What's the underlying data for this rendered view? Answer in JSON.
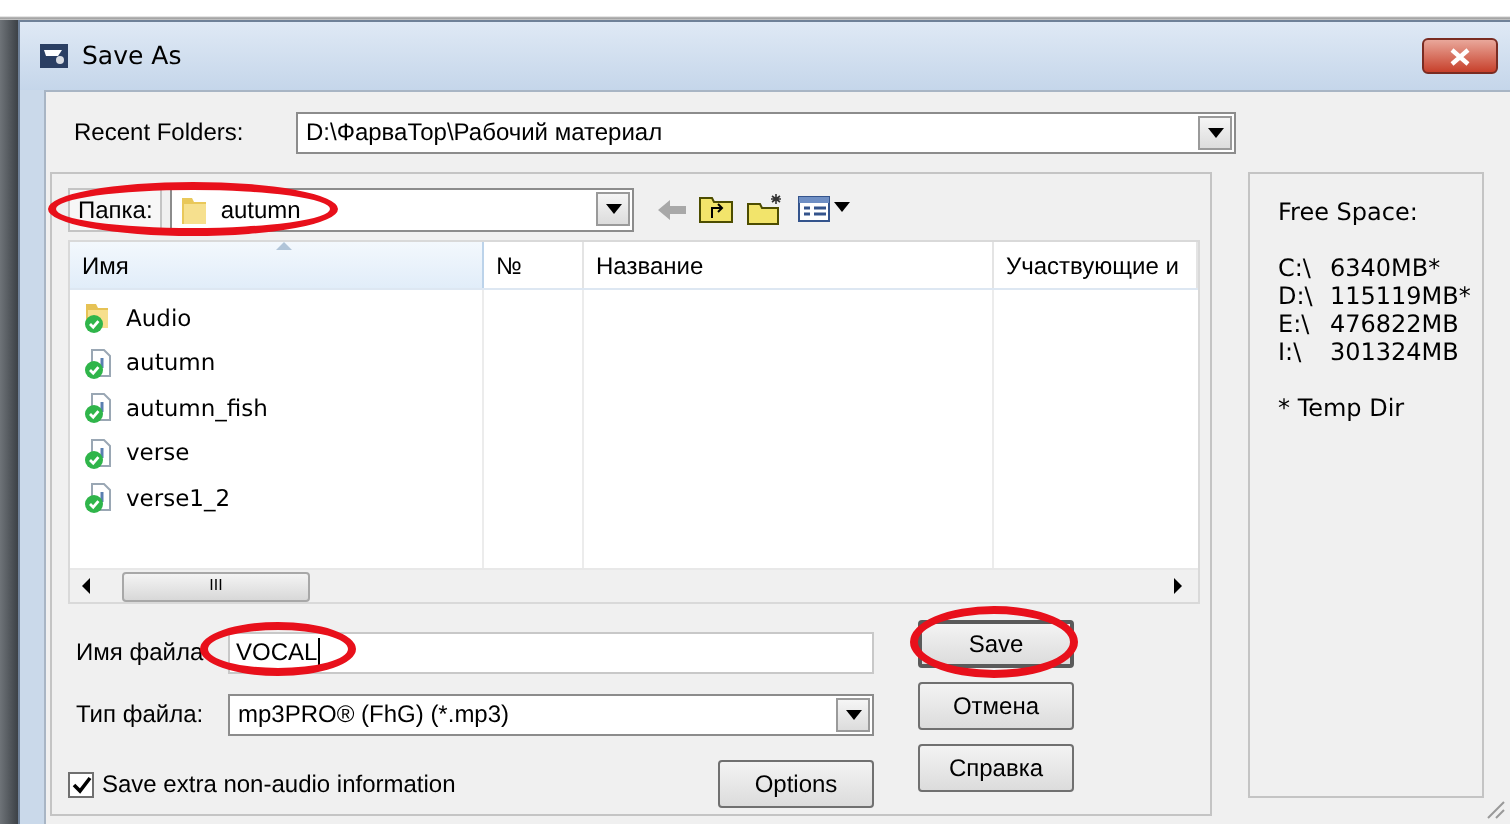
{
  "window": {
    "title": "Save As"
  },
  "recent_folders": {
    "label": "Recent Folders:",
    "value": "D:\\ФарваТор\\Рабочий материал"
  },
  "folder": {
    "label": "Папка:",
    "value": "autumn",
    "circled": true
  },
  "toolbar": {
    "back_disabled": true
  },
  "columns": [
    {
      "label": "Имя",
      "sorted": true
    },
    {
      "label": "№",
      "sorted": false
    },
    {
      "label": "Название",
      "sorted": false
    },
    {
      "label": "Участвующие и",
      "sorted": false
    }
  ],
  "files": [
    {
      "name": "Audio",
      "kind": "folder"
    },
    {
      "name": "autumn",
      "kind": "audio"
    },
    {
      "name": "autumn_fish",
      "kind": "audio"
    },
    {
      "name": "verse",
      "kind": "audio"
    },
    {
      "name": "verse1_2",
      "kind": "audio"
    }
  ],
  "scroll_grip": "III",
  "file_name": {
    "label": "Имя файла",
    "value": "VOCAL",
    "circled": true
  },
  "file_type": {
    "label": "Тип файла:",
    "value": "mp3PRO® (FhG) (*.mp3)"
  },
  "save_extra": {
    "label": "Save extra non-audio information",
    "checked": true
  },
  "buttons": [
    {
      "label": "Save",
      "kind": "save",
      "circled": true
    },
    {
      "label": "Отмена",
      "kind": "cancel",
      "circled": false
    },
    {
      "label": "Options",
      "kind": "options",
      "circled": false
    },
    {
      "label": "Справка",
      "kind": "help",
      "circled": false
    }
  ],
  "free_space": {
    "title": "Free Space:",
    "drives": [
      {
        "drive": "C:\\",
        "size": "6340MB*"
      },
      {
        "drive": "D:\\",
        "size": "115119MB*"
      },
      {
        "drive": "E:\\",
        "size": "476822MB"
      },
      {
        "drive": "I:\\",
        "size": "301324MB"
      }
    ],
    "note": "* Temp Dir"
  }
}
